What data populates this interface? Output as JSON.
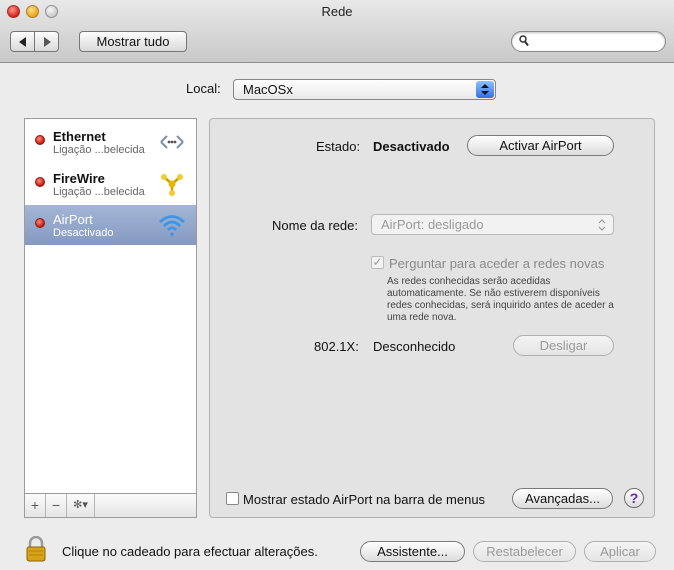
{
  "window": {
    "title": "Rede"
  },
  "toolbar": {
    "show_all_label": "Mostrar tudo",
    "search_placeholder": ""
  },
  "location": {
    "label": "Local:",
    "value": "MacOSx"
  },
  "services": [
    {
      "name": "Ethernet",
      "status": "Ligação ...belecida",
      "icon": "ethernet-icon",
      "selected": false
    },
    {
      "name": "FireWire",
      "status": "Ligação ...belecida",
      "icon": "firewire-icon",
      "selected": false
    },
    {
      "name": "AirPort",
      "status": "Desactivado",
      "icon": "wifi-icon",
      "selected": true
    }
  ],
  "list_toolbar": {
    "add": "+",
    "remove": "−",
    "action": "✻▾"
  },
  "detail": {
    "status_label": "Estado:",
    "status_value": "Desactivado",
    "activate_button": "Activar AirPort",
    "network_name_label": "Nome da rede:",
    "network_name_value": "AirPort: desligado",
    "ask_checkbox_label": "Perguntar para aceder a redes novas",
    "ask_note": "As redes conhecidas serão acedidas automaticamente. Se não estiverem disponíveis redes conhecidas, será inquirido antes de aceder a uma rede nova.",
    "dot1x_label": "802.1X:",
    "dot1x_value": "Desconhecido",
    "disconnect_button": "Desligar",
    "show_menu_checkbox_label": "Mostrar estado AirPort na barra de menus",
    "advanced_button": "Avançadas...",
    "help_label": "?"
  },
  "bottom": {
    "lock_message": "Clique no cadeado para efectuar alterações.",
    "assistant_button": "Assistente...",
    "revert_button": "Restabelecer",
    "apply_button": "Aplicar"
  },
  "colors": {
    "selection": "#8fa3c9",
    "status_red": "#cc1508",
    "wifi_blue": "#3b95e8"
  }
}
